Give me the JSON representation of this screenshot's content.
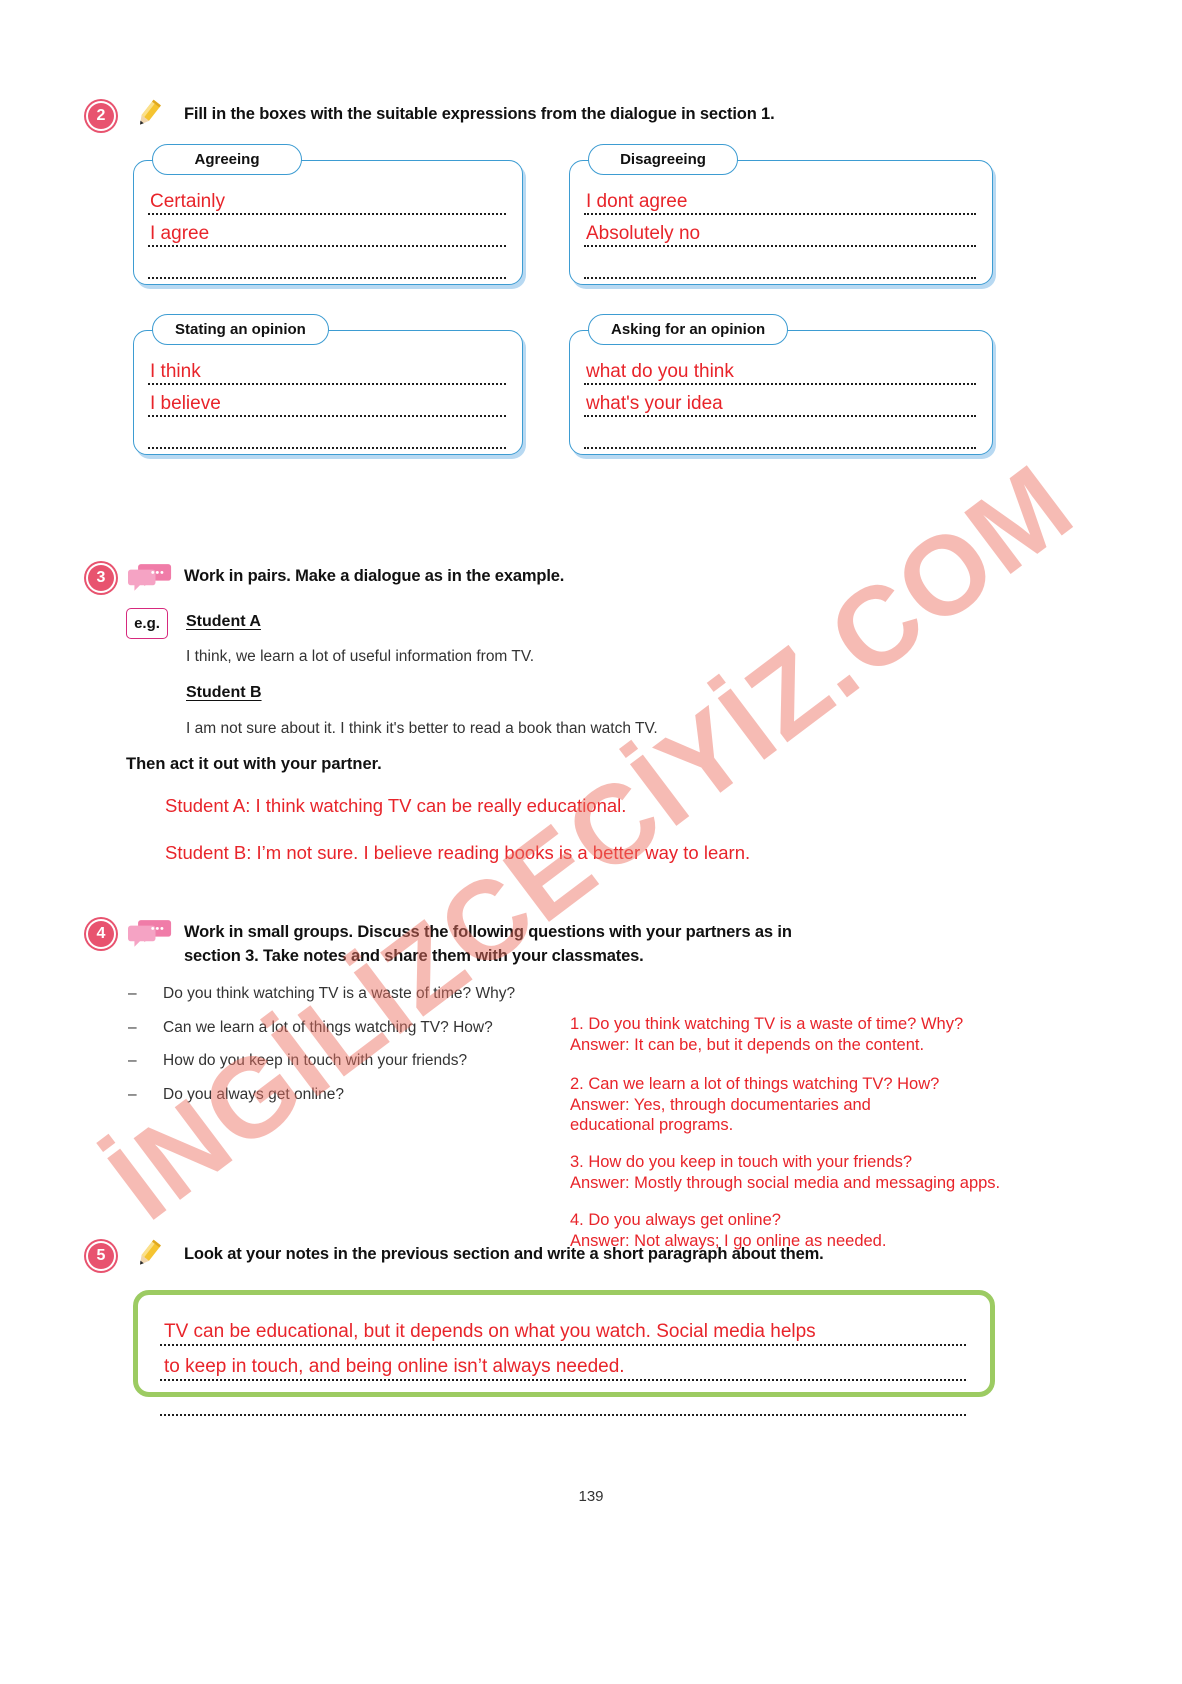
{
  "page": {
    "number": "139",
    "watermark": "İNGİLİZCECİYİZ.COM"
  },
  "exercise2": {
    "number": "2",
    "icon": "pencil-icon",
    "instruction": "Fill in the boxes with the suitable expressions from the dialogue in section 1.",
    "boxes": [
      {
        "label": "Agreeing",
        "answers": [
          "Certainly",
          "I agree"
        ],
        "line_count": 4
      },
      {
        "label": "Disagreeing",
        "answers": [
          "I dont agree",
          "Absolutely no"
        ],
        "line_count": 4
      },
      {
        "label": "Stating an opinion",
        "answers": [
          "I think",
          "I believe"
        ],
        "line_count": 4
      },
      {
        "label": "Asking for an opinion",
        "answers": [
          "what do you think",
          "what's your idea"
        ],
        "line_count": 4
      }
    ]
  },
  "exercise3": {
    "number": "3",
    "icon": "speech-bubbles-icon",
    "instruction": "Work in pairs. Make a dialogue as in the example.",
    "eg_badge": "e.g.",
    "student_a_label": "Student A",
    "student_a_line": "I think, we learn a lot of useful information from TV.",
    "student_b_label": "Student B",
    "student_b_line": "I am not sure about it. I think it's better to read a book than watch TV.",
    "then_act": "Then act it out with your partner.",
    "answers": [
      "Student A: I think watching TV can be really educational.",
      "Student B: I’m not sure. I believe reading books is a better way to learn."
    ]
  },
  "exercise4": {
    "number": "4",
    "icon": "speech-bubbles-icon",
    "instruction_line1": "Work in small groups. Discuss the following questions with your partners as in",
    "instruction_line2": "section 3. Take notes and share them with your classmates.",
    "questions": [
      "Do you think watching TV is a waste of time? Why?",
      "Can we learn a lot of things watching TV? How?",
      "How do you keep in touch with your friends?",
      "Do you always get online?"
    ],
    "notes": [
      {
        "question": "1. Do you think watching TV is a waste of time? Why?",
        "answer": [
          "Answer: It can be, but it depends on the content."
        ]
      },
      {
        "question": "2. Can we learn a lot of things watching TV? How?",
        "answer": [
          "Answer: Yes, through documentaries and",
          "educational programs."
        ]
      },
      {
        "question": "3. How do you keep in touch with your friends?",
        "answer": [
          "Answer: Mostly through social media and messaging apps."
        ]
      },
      {
        "question": "4. Do you always get online?",
        "answer": [
          "Answer: Not always; I go online as needed."
        ]
      }
    ]
  },
  "exercise5": {
    "number": "5",
    "icon": "pencil-icon",
    "instruction": "Look at your notes in the previous section and write a short paragraph about them.",
    "answer_lines": [
      "TV can be educational, but it depends on what you watch. Social media helps",
      "to keep in touch, and being online isn’t always needed."
    ],
    "line_count": 3
  },
  "colors": {
    "accent_pink": "#e8536f",
    "handwriting_red": "#e8242a",
    "box_blue": "#3d9cd2",
    "box_shadow_blue": "#7db9e8",
    "green_border": "#9ccb62",
    "watermark": "#ec7063"
  }
}
